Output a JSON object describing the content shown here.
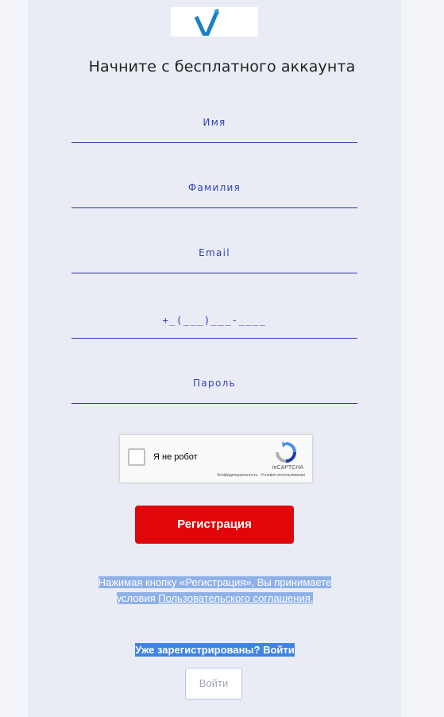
{
  "header": {
    "headline": "Начните с бесплатного аккаунта"
  },
  "form": {
    "first_name": {
      "placeholder": "Имя",
      "value": ""
    },
    "last_name": {
      "placeholder": "Фамилия",
      "value": ""
    },
    "email": {
      "placeholder": "Email",
      "value": ""
    },
    "phone": {
      "placeholder": "",
      "mask": "+_(___)___-____",
      "value": ""
    },
    "password": {
      "placeholder": "Пароль",
      "value": ""
    }
  },
  "captcha": {
    "label": "Я не робот",
    "brand": "reCAPTCHA",
    "links": "Конфиденциальность - Условия использования"
  },
  "register_button": {
    "label": "Регистрация"
  },
  "terms": {
    "line1": "Нажимая кнопку «Регистрация», Вы принимаете",
    "line2_prefix": "условия ",
    "link": "Пользовательского соглашения."
  },
  "login": {
    "question": "Уже зарегистрированы? Войти",
    "button_label": "Войти"
  },
  "colors": {
    "accent": "#2b35b0",
    "register_button": "#e0060a",
    "selection": "#3e84e6",
    "logo_mark": "#1a7fc6"
  },
  "icons": {
    "logo": "v-check-logo-icon",
    "captcha": "recaptcha-icon"
  }
}
